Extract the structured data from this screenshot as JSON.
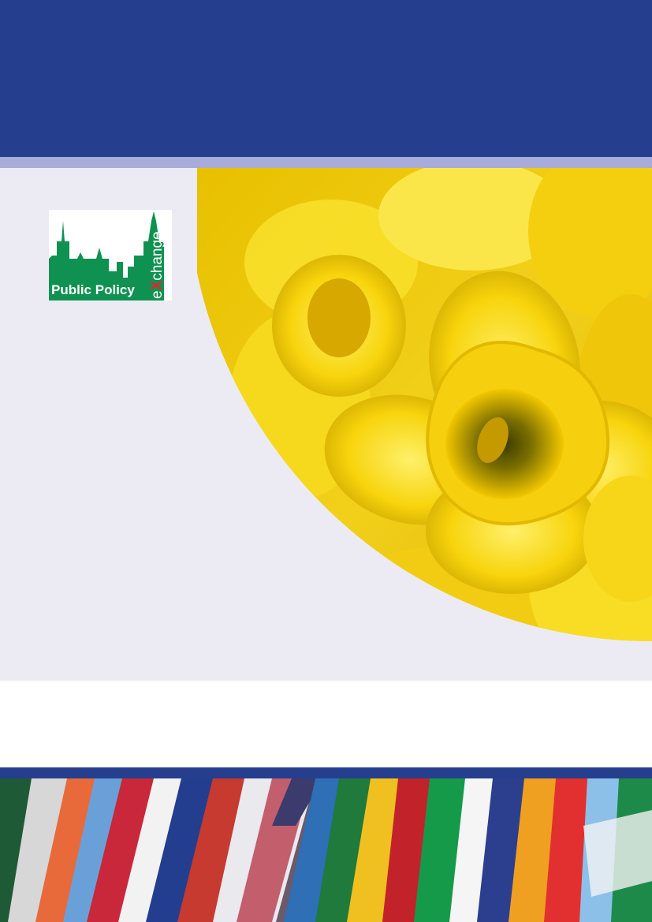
{
  "colors": {
    "band_blue": "#253f8e",
    "stripe_lavender": "#a8acd8",
    "panel_grey": "#ecebf4",
    "logo_green": "#0f9251",
    "logo_red": "#e3262b",
    "daffodil_yellow": "#f7d40c"
  },
  "logo": {
    "line1": "Public Policy",
    "x_letter": "X",
    "word_part1": "e",
    "word_part2": "change"
  },
  "images": {
    "hero": "daffodil-flowers-photo",
    "footer": "international-flags-photo"
  }
}
